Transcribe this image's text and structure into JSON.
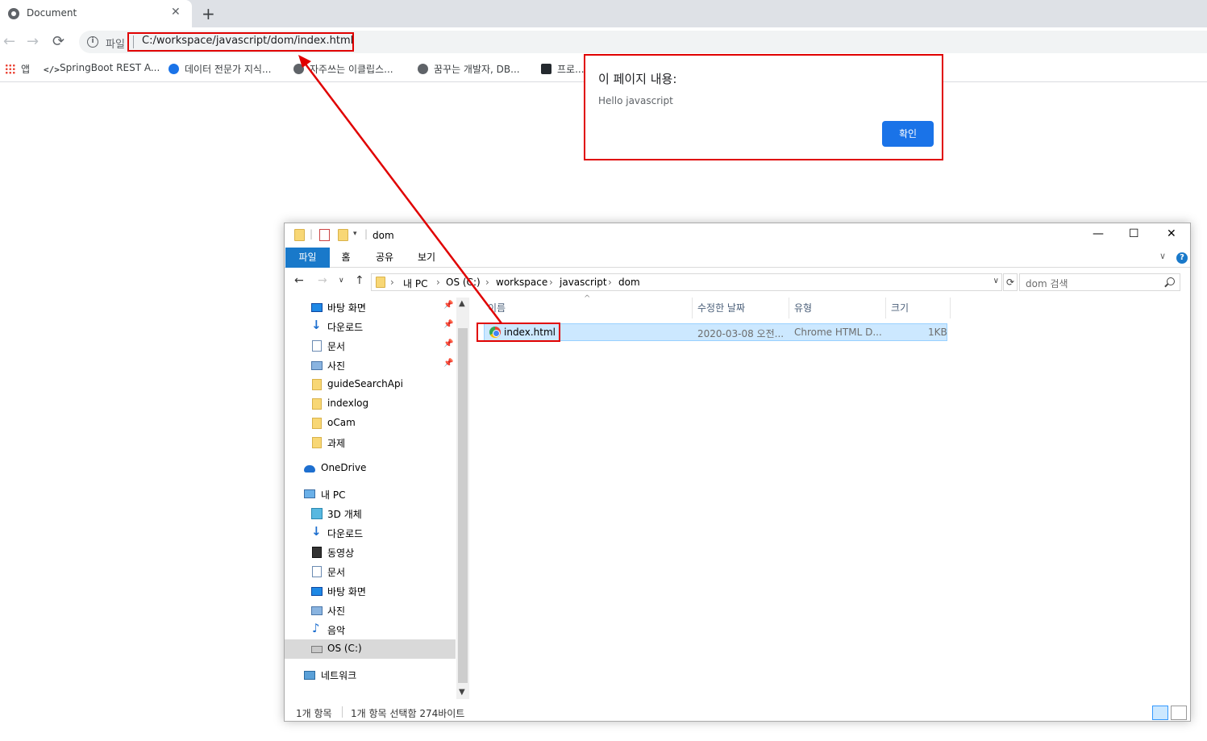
{
  "browser": {
    "tab_title": "Document",
    "tab_close": "✕",
    "new_tab": "+",
    "back": "←",
    "forward": "→",
    "reload": "⟳",
    "info_icon_glyph": "i",
    "scheme_label": "파일",
    "url": "C:/workspace/javascript/dom/index.html",
    "bookmarks": [
      {
        "label": "앱",
        "icon": "apps-icon"
      },
      {
        "label": "SpringBoot REST A...",
        "icon": "code-icon"
      },
      {
        "label": "데이터 전문가 지식...",
        "icon": "globe-icon"
      },
      {
        "label": "자주쓰는 이클립스...",
        "icon": "globe-icon"
      },
      {
        "label": "꿈꾸는 개발자, DB...",
        "icon": "globe-icon"
      },
      {
        "label": "프로...",
        "icon": "bookmark-icon"
      }
    ]
  },
  "alert": {
    "title": "이 페이지 내용:",
    "message": "Hello javascript",
    "ok_label": "확인"
  },
  "explorer": {
    "title": "dom",
    "minimize": "—",
    "maximize": "☐",
    "close": "✕",
    "ribbon_tabs": [
      "파일",
      "홈",
      "공유",
      "보기"
    ],
    "ribbon_expand": "∨",
    "help": "?",
    "nav_back": "←",
    "nav_forward": "→",
    "nav_recent": "∨",
    "nav_up": "↑",
    "breadcrumbs": [
      "내 PC",
      "OS (C:)",
      "workspace",
      "javascript",
      "dom"
    ],
    "crumb_sep": "›",
    "address_dropdown": "∨",
    "refresh": "⟳",
    "search_placeholder": "dom 검색",
    "nav_items": [
      {
        "label": "바탕 화면",
        "icon": "desktop-icon",
        "pinned": true
      },
      {
        "label": "다운로드",
        "icon": "download-icon",
        "pinned": true
      },
      {
        "label": "문서",
        "icon": "document-icon",
        "pinned": true
      },
      {
        "label": "사진",
        "icon": "pictures-icon",
        "pinned": true
      },
      {
        "label": "guideSearchApi",
        "icon": "folder-icon"
      },
      {
        "label": "indexlog",
        "icon": "folder-icon"
      },
      {
        "label": "oCam",
        "icon": "folder-icon"
      },
      {
        "label": "과제",
        "icon": "folder-icon"
      },
      {
        "label": "OneDrive",
        "icon": "onedrive-icon"
      },
      {
        "label": "내 PC",
        "icon": "pc-icon"
      },
      {
        "label": "3D 개체",
        "icon": "3d-objects-icon"
      },
      {
        "label": "다운로드",
        "icon": "download-icon"
      },
      {
        "label": "동영상",
        "icon": "video-icon"
      },
      {
        "label": "문서",
        "icon": "document-icon"
      },
      {
        "label": "바탕 화면",
        "icon": "desktop-icon"
      },
      {
        "label": "사진",
        "icon": "pictures-icon"
      },
      {
        "label": "음악",
        "icon": "music-icon"
      },
      {
        "label": "OS (C:)",
        "icon": "drive-icon",
        "selected": true
      },
      {
        "label": "네트워크",
        "icon": "network-icon"
      }
    ],
    "pin_glyph": "📌",
    "columns": [
      "이름",
      "수정한 날짜",
      "유형",
      "크기"
    ],
    "sort_indicator": "^",
    "files": [
      {
        "name": "index.html",
        "modified": "2020-03-08 오전...",
        "type": "Chrome HTML D...",
        "size": "1KB",
        "selected": true
      }
    ],
    "status_items": "1개 항목",
    "status_selection": "1개 항목 선택함 274바이트",
    "scroll_up": "▲",
    "scroll_down": "▼"
  },
  "colors": {
    "annotation": "#e00000",
    "dialog_button": "#1a73e8",
    "ribbon_file_tab": "#1979ca",
    "selection": "#cce8ff"
  }
}
